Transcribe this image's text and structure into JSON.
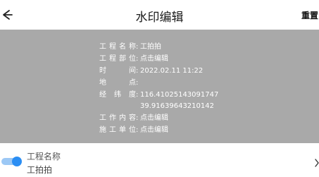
{
  "header": {
    "back_icon": "arrow-left-icon",
    "title": "水印编辑",
    "reset_label": "重置"
  },
  "watermark": {
    "project_name": {
      "label": [
        "工",
        "程",
        "名",
        "称"
      ],
      "value": "工拍拍"
    },
    "project_part": {
      "label": [
        "工",
        "程",
        "部",
        "位"
      ],
      "value": "点击编辑"
    },
    "time": {
      "label": [
        "时",
        "间"
      ],
      "value": "2022.02.11 11:22"
    },
    "location": {
      "label": [
        "地",
        "点"
      ],
      "value": ""
    },
    "coords": {
      "label": [
        "经",
        "纬",
        "度"
      ],
      "value_lng": "116.41025143091747",
      "value_lat": "39.91639643210142"
    },
    "work_content": {
      "label": [
        "工",
        "作",
        "内",
        "容"
      ],
      "value": "点击编辑"
    },
    "construction_unit": {
      "label": [
        "施",
        "工",
        "单",
        "位"
      ],
      "value": "点击编辑"
    }
  },
  "settings": {
    "item": {
      "label": "工程名称",
      "value": "工拍拍",
      "enabled": true
    },
    "chevron_icon": "chevron-right-icon"
  },
  "colors": {
    "preview_bg": "#a9a9a9",
    "toggle_on": "#2b8ef3",
    "toggle_track": "#9cc8f5"
  }
}
